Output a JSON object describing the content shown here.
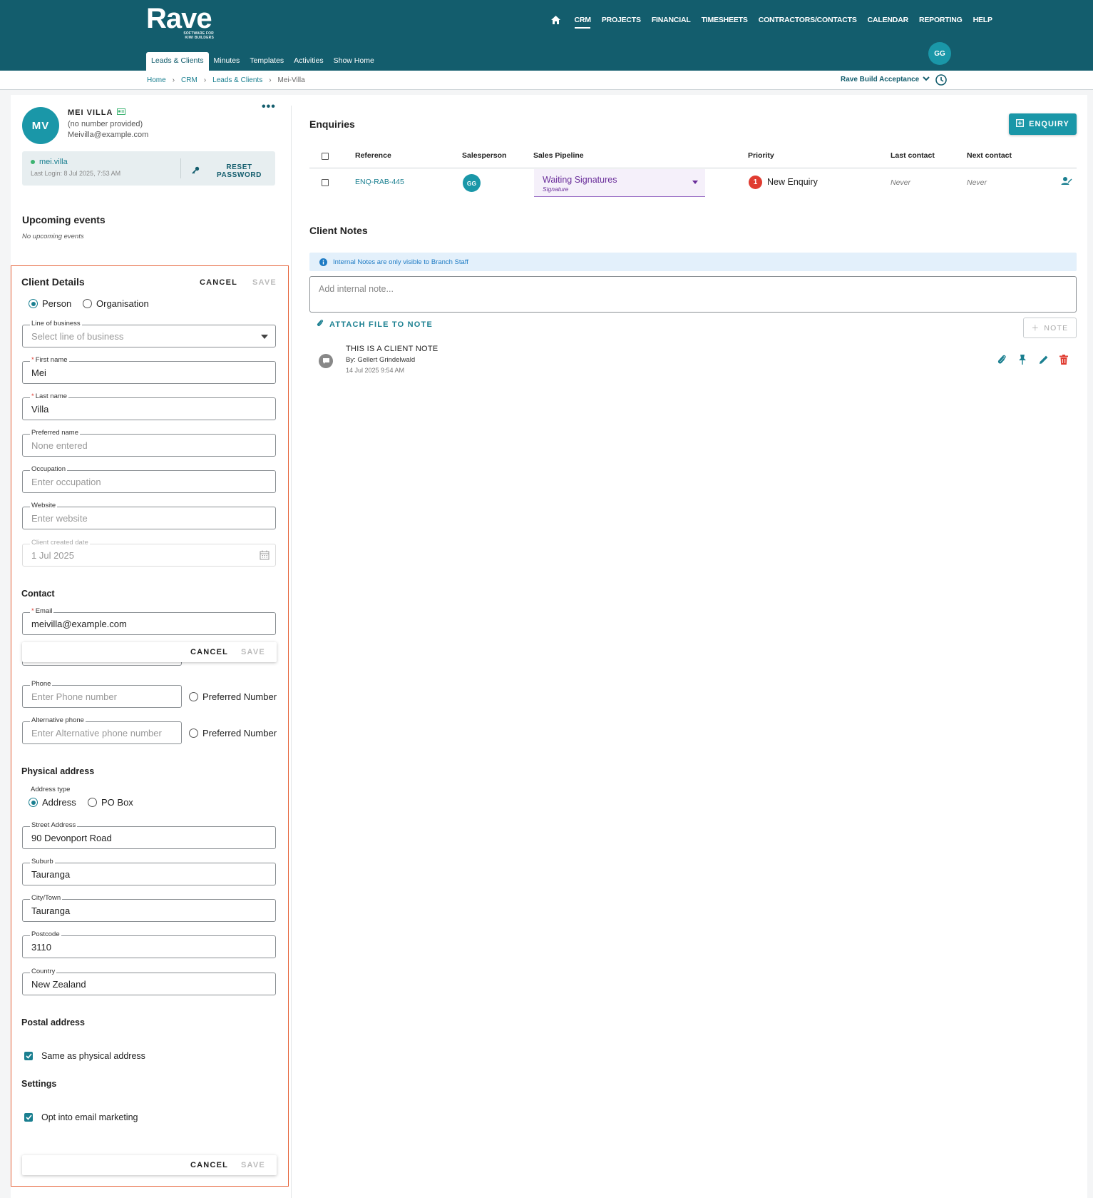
{
  "header": {
    "brand": "Rave",
    "tagline_1": "SOFTWARE FOR",
    "tagline_2": "KIWI BUILDERS",
    "nav": [
      "CRM",
      "PROJECTS",
      "FINANCIAL",
      "TIMESHEETS",
      "CONTRACTORS/CONTACTS",
      "CALENDAR",
      "REPORTING",
      "HELP"
    ],
    "active_nav": "CRM",
    "subtabs": [
      "Leads & Clients",
      "Minutes",
      "Templates",
      "Activities",
      "Show Home"
    ],
    "active_subtab": "Leads & Clients",
    "user_initials": "GG",
    "colors": {
      "primary": "#135d6d",
      "accent": "#1a97a8",
      "danger": "#e03c31",
      "highlight_border": "#e6633a"
    }
  },
  "breadcrumb": {
    "items": [
      "Home",
      "CRM",
      "Leads & Clients"
    ],
    "current": "Mei-Villa",
    "org": "Rave Build Acceptance"
  },
  "client": {
    "initials": "MV",
    "name": "MEI VILLA",
    "phone": "(no number provided)",
    "email": "Meivilla@example.com",
    "username": "mei.villa",
    "last_login": "Last Login: 8 Jul 2025, 7:53 AM",
    "reset_label": "RESET PASSWORD",
    "more_label": "•••"
  },
  "upcoming": {
    "title": "Upcoming events",
    "empty": "No upcoming events"
  },
  "details": {
    "title": "Client Details",
    "cancel": "CANCEL",
    "save": "SAVE",
    "type_person": "Person",
    "type_org": "Organisation",
    "line_of_business": {
      "label": "Line of business",
      "placeholder": "Select line of business"
    },
    "first_name": {
      "label": "First name",
      "value": "Mei"
    },
    "last_name": {
      "label": "Last name",
      "value": "Villa"
    },
    "preferred_name": {
      "label": "Preferred name",
      "placeholder": "None entered"
    },
    "occupation": {
      "label": "Occupation",
      "placeholder": "Enter occupation"
    },
    "website": {
      "label": "Website",
      "placeholder": "Enter website"
    },
    "created": {
      "label": "Client created date",
      "value": "1 Jul 2025"
    },
    "contact_title": "Contact",
    "email": {
      "label": "Email",
      "value": "meivilla@example.com"
    },
    "phone": {
      "label": "Phone",
      "placeholder": "Enter Phone number"
    },
    "alt_phone": {
      "label": "Alternative phone",
      "placeholder": "Enter Alternative phone number"
    },
    "preferred_number": "Preferred Number",
    "physical_title": "Physical address",
    "address_type_label": "Address type",
    "address_type_address": "Address",
    "address_type_po": "PO Box",
    "street": {
      "label": "Street Address",
      "value": "90 Devonport Road"
    },
    "suburb": {
      "label": "Suburb",
      "value": "Tauranga"
    },
    "city": {
      "label": "City/Town",
      "value": "Tauranga"
    },
    "postcode": {
      "label": "Postcode",
      "value": "3110"
    },
    "country": {
      "label": "Country",
      "value": "New Zealand"
    },
    "postal_title": "Postal address",
    "same_as_physical": "Same as physical address",
    "settings_title": "Settings",
    "opt_in": "Opt into email marketing"
  },
  "enquiries": {
    "title": "Enquiries",
    "add_label": "ENQUIRY",
    "columns": [
      "Reference",
      "Salesperson",
      "Sales Pipeline",
      "Priority",
      "Last contact",
      "Next contact"
    ],
    "rows": [
      {
        "reference": "ENQ-RAB-445",
        "salesperson": "GG",
        "pipeline": "Waiting Signatures",
        "pipeline_sub": "Signature",
        "priority_num": "1",
        "priority": "New Enquiry",
        "last_contact": "Never",
        "next_contact": "Never"
      }
    ]
  },
  "notes": {
    "title": "Client Notes",
    "info": "Internal Notes are only visible to Branch Staff",
    "placeholder": "Add internal note...",
    "attach": "ATTACH FILE TO NOTE",
    "add": "NOTE",
    "items": [
      {
        "title": "THIS IS A CLIENT NOTE",
        "by": "By: Gellert Grindelwald",
        "date": "14 Jul 2025 9:54 AM"
      }
    ]
  }
}
